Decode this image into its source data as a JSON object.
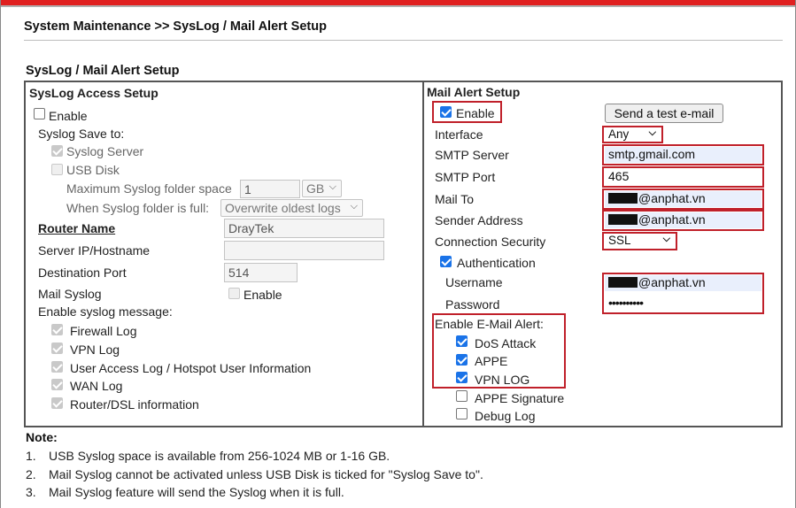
{
  "header": {
    "breadcrumb": "System Maintenance >> SysLog / Mail Alert Setup",
    "section_title": "SysLog / Mail Alert Setup"
  },
  "syslog": {
    "title": "SysLog Access Setup",
    "enable_label": "Enable",
    "enable_checked": false,
    "save_to_label": "Syslog Save to:",
    "syslog_server_label": "Syslog Server",
    "usb_disk_label": "USB Disk",
    "max_space_label": "Maximum Syslog folder space",
    "max_space_value": "1",
    "max_space_unit": "GB",
    "when_full_label": "When Syslog folder is full:",
    "when_full_value": "Overwrite oldest logs",
    "router_name_label": "Router Name",
    "router_name_value": "DrayTek",
    "server_ip_label": "Server IP/Hostname",
    "server_ip_value": "",
    "dest_port_label": "Destination Port",
    "dest_port_value": "514",
    "mail_syslog_label": "Mail Syslog",
    "mail_syslog_enable_label": "Enable",
    "enable_message_label": "Enable syslog message:",
    "messages": [
      "Firewall Log",
      "VPN Log",
      "User Access Log / Hotspot User Information",
      "WAN Log",
      "Router/DSL information"
    ]
  },
  "mail": {
    "title": "Mail Alert Setup",
    "enable_label": "Enable",
    "test_button_label": "Send a test e-mail",
    "interface_label": "Interface",
    "interface_value": "Any",
    "smtp_server_label": "SMTP Server",
    "smtp_server_value": "smtp.gmail.com",
    "smtp_port_label": "SMTP Port",
    "smtp_port_value": "465",
    "mail_to_label": "Mail To",
    "mail_to_value": "@anphat.vn",
    "sender_label": "Sender Address",
    "sender_value": "@anphat.vn",
    "security_label": "Connection Security",
    "security_value": "SSL",
    "auth_label": "Authentication",
    "username_label": "Username",
    "username_value": "@anphat.vn",
    "password_label": "Password",
    "password_value": "••••••••••",
    "alerts_label": "Enable E-Mail Alert:",
    "alerts": [
      {
        "label": "DoS Attack",
        "checked": true
      },
      {
        "label": "APPE",
        "checked": true
      },
      {
        "label": "VPN LOG",
        "checked": true
      },
      {
        "label": "APPE Signature",
        "checked": false
      },
      {
        "label": "Debug Log",
        "checked": false
      }
    ]
  },
  "notes": {
    "title": "Note:",
    "items": [
      {
        "num": "1.",
        "text": "USB Syslog space is available from 256-1024 MB or 1-16 GB."
      },
      {
        "num": "2.",
        "text": "Mail Syslog cannot be activated unless USB Disk is ticked for \"Syslog Save to\"."
      },
      {
        "num": "3.",
        "text": "Mail Syslog feature will send the Syslog when it is full."
      }
    ]
  },
  "colors": {
    "highlight_red": "#c0202a",
    "checkbox_blue": "#1a73e8"
  }
}
